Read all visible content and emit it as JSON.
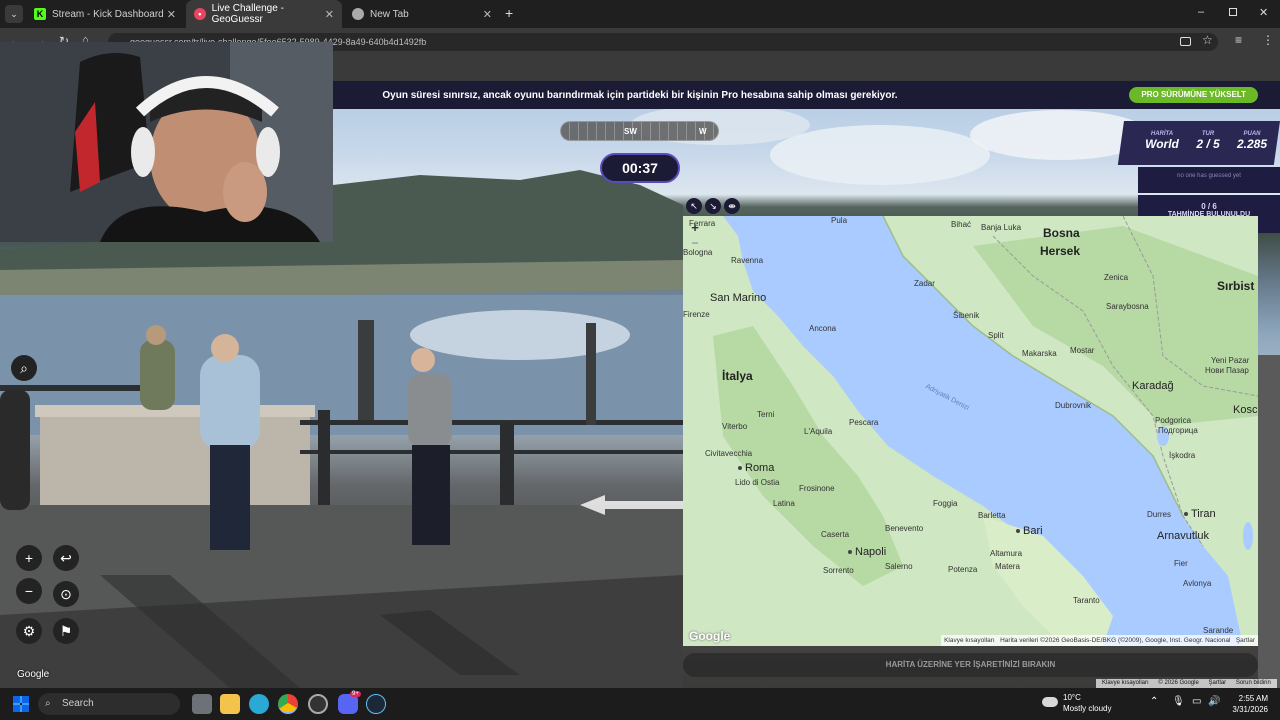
{
  "browser": {
    "tabs": [
      {
        "title": "Stream - Kick Dashboard",
        "active": false
      },
      {
        "title": "Live Challenge - GeoGuessr",
        "active": true
      },
      {
        "title": "New Tab",
        "active": false
      }
    ],
    "new_tab_symbol": "+",
    "url": "geoguessr.com/tr/live-challenge/5fee6532-5989-4429-8a49-640b4d1492fb"
  },
  "game": {
    "banner_text": "Oyun süresi sınırsız, ancak oyunu barındırmak için partideki bir kişinin Pro hesabına sahip olması gerekiyor.",
    "upgrade_button": "PRO SÜRÜMÜNE YÜKSELT",
    "compass": {
      "left_dir": "SW",
      "right_dir": "W"
    },
    "timer": "00:37",
    "score": {
      "map_label": "HARİTA",
      "map_value": "World",
      "round_label": "TUR",
      "round_value": "2 / 5",
      "points_label": "PUAN",
      "points_value": "2.285"
    },
    "no_one_guessed": "no one has guessed yet",
    "guess_count": "0 / 6",
    "guess_count_label": "TAHMİNDE BULUNULDU",
    "place_guess": "HARİTA ÜZERİNE YER İŞARETİNİZİ BIRAKIN"
  },
  "map": {
    "labels": [
      {
        "text": "Bosna",
        "cls": "big"
      },
      {
        "text": "Hersek",
        "cls": "big"
      },
      {
        "text": "Sırbist",
        "cls": "big"
      },
      {
        "text": "San Marino",
        "cls": "mid"
      },
      {
        "text": "İtalya",
        "cls": "big"
      },
      {
        "text": "Karadağ",
        "cls": "mid"
      },
      {
        "text": "Arnavutluk",
        "cls": "mid"
      },
      {
        "text": "Kosc",
        "cls": "mid"
      },
      {
        "text": "Roma",
        "cls": "mid"
      },
      {
        "text": "Napoli",
        "cls": "mid"
      },
      {
        "text": "Bari",
        "cls": "mid"
      },
      {
        "text": "Tiran",
        "cls": "mid"
      },
      {
        "text": "Pula",
        "cls": "small"
      },
      {
        "text": "Bihać",
        "cls": "small"
      },
      {
        "text": "Banja Luka",
        "cls": "small"
      },
      {
        "text": "Ferrara",
        "cls": "small"
      },
      {
        "text": "Bologna",
        "cls": "small"
      },
      {
        "text": "Ravenna",
        "cls": "small"
      },
      {
        "text": "Zenica",
        "cls": "small"
      },
      {
        "text": "Zadar",
        "cls": "small"
      },
      {
        "text": "Saraybosna",
        "cls": "small"
      },
      {
        "text": "Firenze",
        "cls": "small"
      },
      {
        "text": "Ancona",
        "cls": "small"
      },
      {
        "text": "Šibenik",
        "cls": "small"
      },
      {
        "text": "Split",
        "cls": "small"
      },
      {
        "text": "Makarska",
        "cls": "small"
      },
      {
        "text": "Mostar",
        "cls": "small"
      },
      {
        "text": "Yeni Pazar",
        "cls": "small"
      },
      {
        "text": "Нови Пазар",
        "cls": "small"
      },
      {
        "text": "Dubrovnik",
        "cls": "small"
      },
      {
        "text": "Terni",
        "cls": "small"
      },
      {
        "text": "Pescara",
        "cls": "small"
      },
      {
        "text": "Podgorica",
        "cls": "small"
      },
      {
        "text": "Подгорица",
        "cls": "small"
      },
      {
        "text": "Viterbo",
        "cls": "small"
      },
      {
        "text": "L'Aquila",
        "cls": "small"
      },
      {
        "text": "Civitavecchia",
        "cls": "small"
      },
      {
        "text": "İşkodra",
        "cls": "small"
      },
      {
        "text": "Lido di Ostia",
        "cls": "small"
      },
      {
        "text": "Frosinone",
        "cls": "small"
      },
      {
        "text": "Foggia",
        "cls": "small"
      },
      {
        "text": "Latina",
        "cls": "small"
      },
      {
        "text": "Barletta",
        "cls": "small"
      },
      {
        "text": "Durres",
        "cls": "small"
      },
      {
        "text": "Benevento",
        "cls": "small"
      },
      {
        "text": "Caserta",
        "cls": "small"
      },
      {
        "text": "Altamura",
        "cls": "small"
      },
      {
        "text": "Matera",
        "cls": "small"
      },
      {
        "text": "Salerno",
        "cls": "small"
      },
      {
        "text": "Potenza",
        "cls": "small"
      },
      {
        "text": "Sorrento",
        "cls": "small"
      },
      {
        "text": "Fier",
        "cls": "small"
      },
      {
        "text": "Avlonya",
        "cls": "small"
      },
      {
        "text": "Taranto",
        "cls": "small"
      },
      {
        "text": "Sarande",
        "cls": "small"
      },
      {
        "text": "Adriyatik Denizi",
        "cls": "sea"
      }
    ],
    "zoom_in": "+",
    "zoom_out": "−",
    "google_logo": "Google",
    "attribution": [
      "Klavye kısayolları",
      "Harita verileri ©2026 GeoBasis-DE/BKG (©2009), Google, Inst. Geogr. Nacional",
      "Şartlar"
    ]
  },
  "streetview": {
    "google": "Google",
    "attribution": [
      "Klavye kısayolları",
      "© 2026 Google",
      "Şartlar",
      "Sorun bildirin"
    ]
  },
  "taskbar": {
    "search": "Search",
    "weather_temp": "10°C",
    "weather_desc": "Mostly cloudy",
    "time": "2:55 AM",
    "date": "3/31/2026",
    "discord_badge": "9+"
  }
}
